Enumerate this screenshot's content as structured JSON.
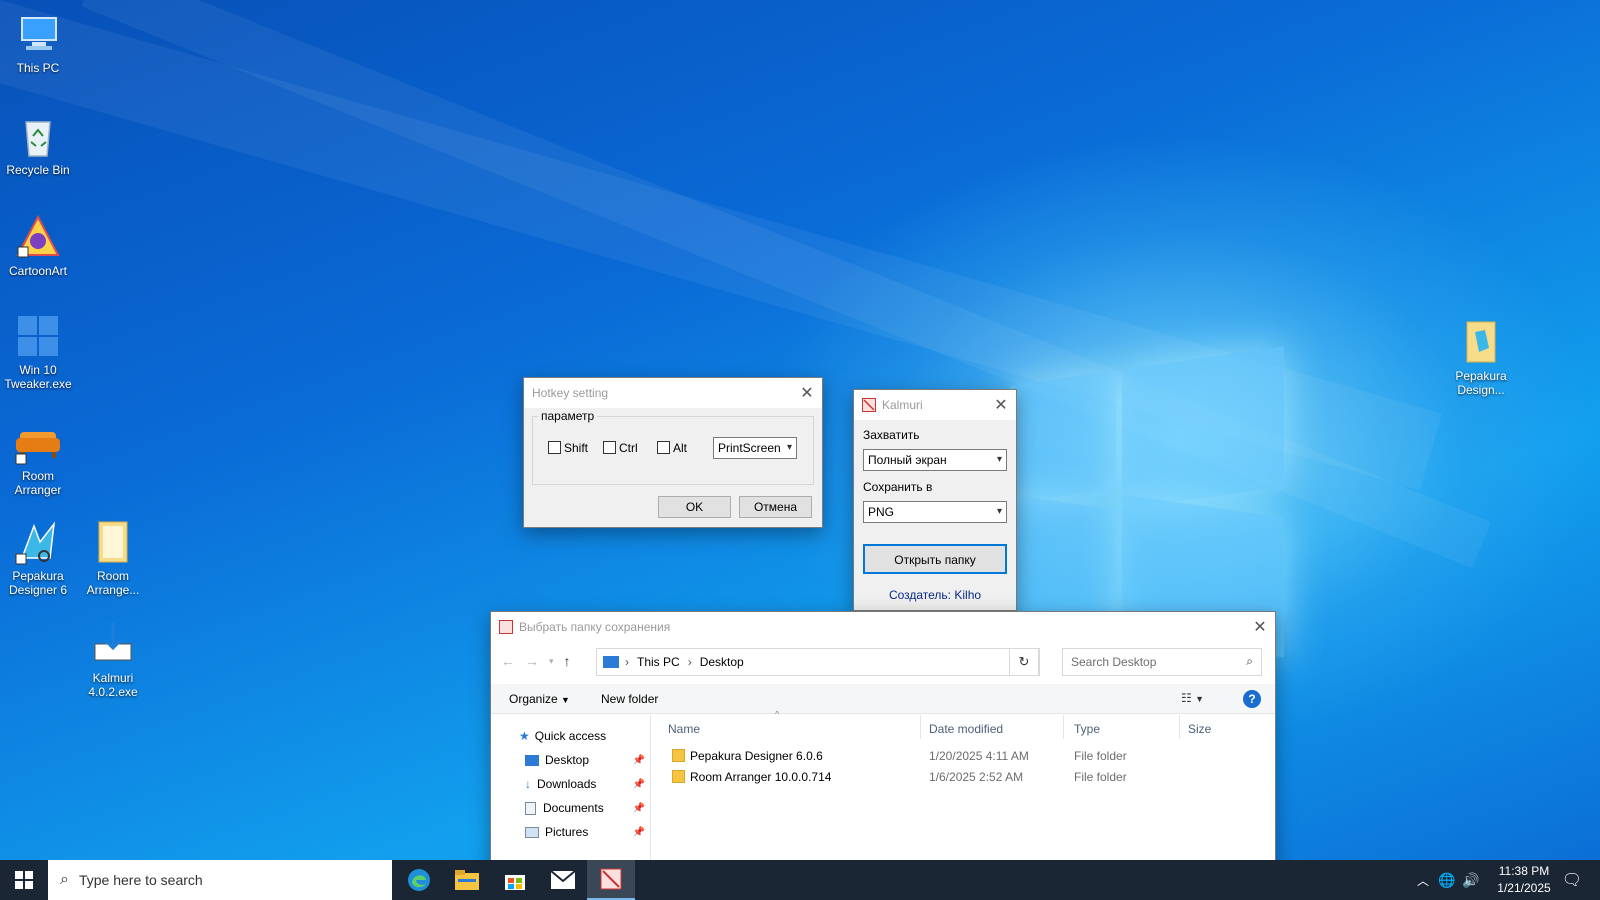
{
  "desktop_icons": [
    {
      "label": "This PC"
    },
    {
      "label": "Recycle Bin"
    },
    {
      "label": "CartoonArt"
    },
    {
      "label": "Win 10 Tweaker.exe"
    },
    {
      "label": "Room Arranger"
    },
    {
      "label": "Pepakura Designer 6"
    },
    {
      "label": "Room Arrange..."
    },
    {
      "label": "Kalmuri 4.0.2.exe"
    },
    {
      "label": "Pepakura Design..."
    }
  ],
  "hotkey_dialog": {
    "title": "Hotkey setting",
    "group_label": "параметр",
    "shift_label": "Shift",
    "ctrl_label": "Ctrl",
    "alt_label": "Alt",
    "key_value": "PrintScreen",
    "ok_label": "OK",
    "cancel_label": "Отмена"
  },
  "kalmuri_window": {
    "title": "Kalmuri",
    "capture_label": "Захватить",
    "capture_value": "Полный экран",
    "save_label": "Сохранить в",
    "save_value": "PNG",
    "open_folder_label": "Открыть папку",
    "creator_text": "Создатель: Kilho"
  },
  "folder_dialog": {
    "title": "Выбрать папку сохранения",
    "breadcrumb": [
      "This PC",
      "Desktop"
    ],
    "search_placeholder": "Search Desktop",
    "organize_label": "Organize",
    "new_folder_label": "New folder",
    "nav": [
      {
        "label": "Quick access"
      },
      {
        "label": "Desktop"
      },
      {
        "label": "Downloads"
      },
      {
        "label": "Documents"
      },
      {
        "label": "Pictures"
      }
    ],
    "columns": [
      "Name",
      "Date modified",
      "Type",
      "Size"
    ],
    "rows": [
      {
        "name": "Pepakura Designer 6.0.6",
        "date": "1/20/2025 4:11 AM",
        "type": "File folder",
        "size": ""
      },
      {
        "name": "Room Arranger 10.0.0.714",
        "date": "1/6/2025 2:52 AM",
        "type": "File folder",
        "size": ""
      }
    ]
  },
  "taskbar": {
    "search_placeholder": "Type here to search",
    "time": "11:38 PM",
    "date": "1/21/2025"
  },
  "colors": {
    "accent": "#0078d7",
    "taskbar": "#1b2634",
    "folder": "#f5c542"
  }
}
